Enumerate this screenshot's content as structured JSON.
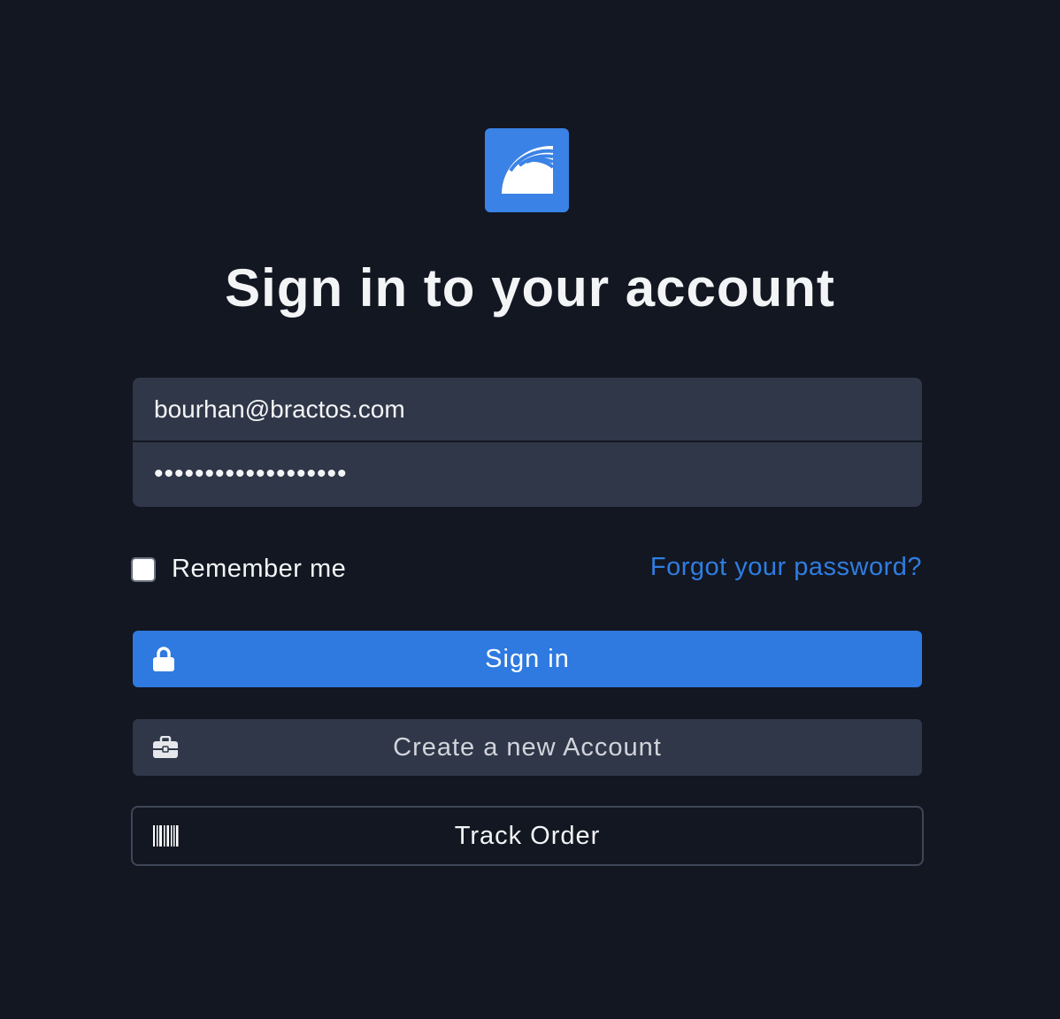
{
  "logo": {
    "icon": "rainbow-arc-icon",
    "color": "#3b82e6"
  },
  "title": "Sign in to your account",
  "form": {
    "email_value": "bourhan@bractos.com",
    "password_value": "•••••••••••••••••••",
    "remember_label": "Remember me",
    "remember_checked": false,
    "forgot_label": "Forgot your password?"
  },
  "buttons": {
    "signin": {
      "label": "Sign in",
      "icon": "lock-icon"
    },
    "create": {
      "label": "Create a new Account",
      "icon": "briefcase-icon"
    },
    "track": {
      "label": "Track Order",
      "icon": "barcode-icon"
    }
  },
  "colors": {
    "background": "#131722",
    "accent": "#2e7ae0",
    "field": "#2f3748",
    "link": "#2f7de1"
  }
}
